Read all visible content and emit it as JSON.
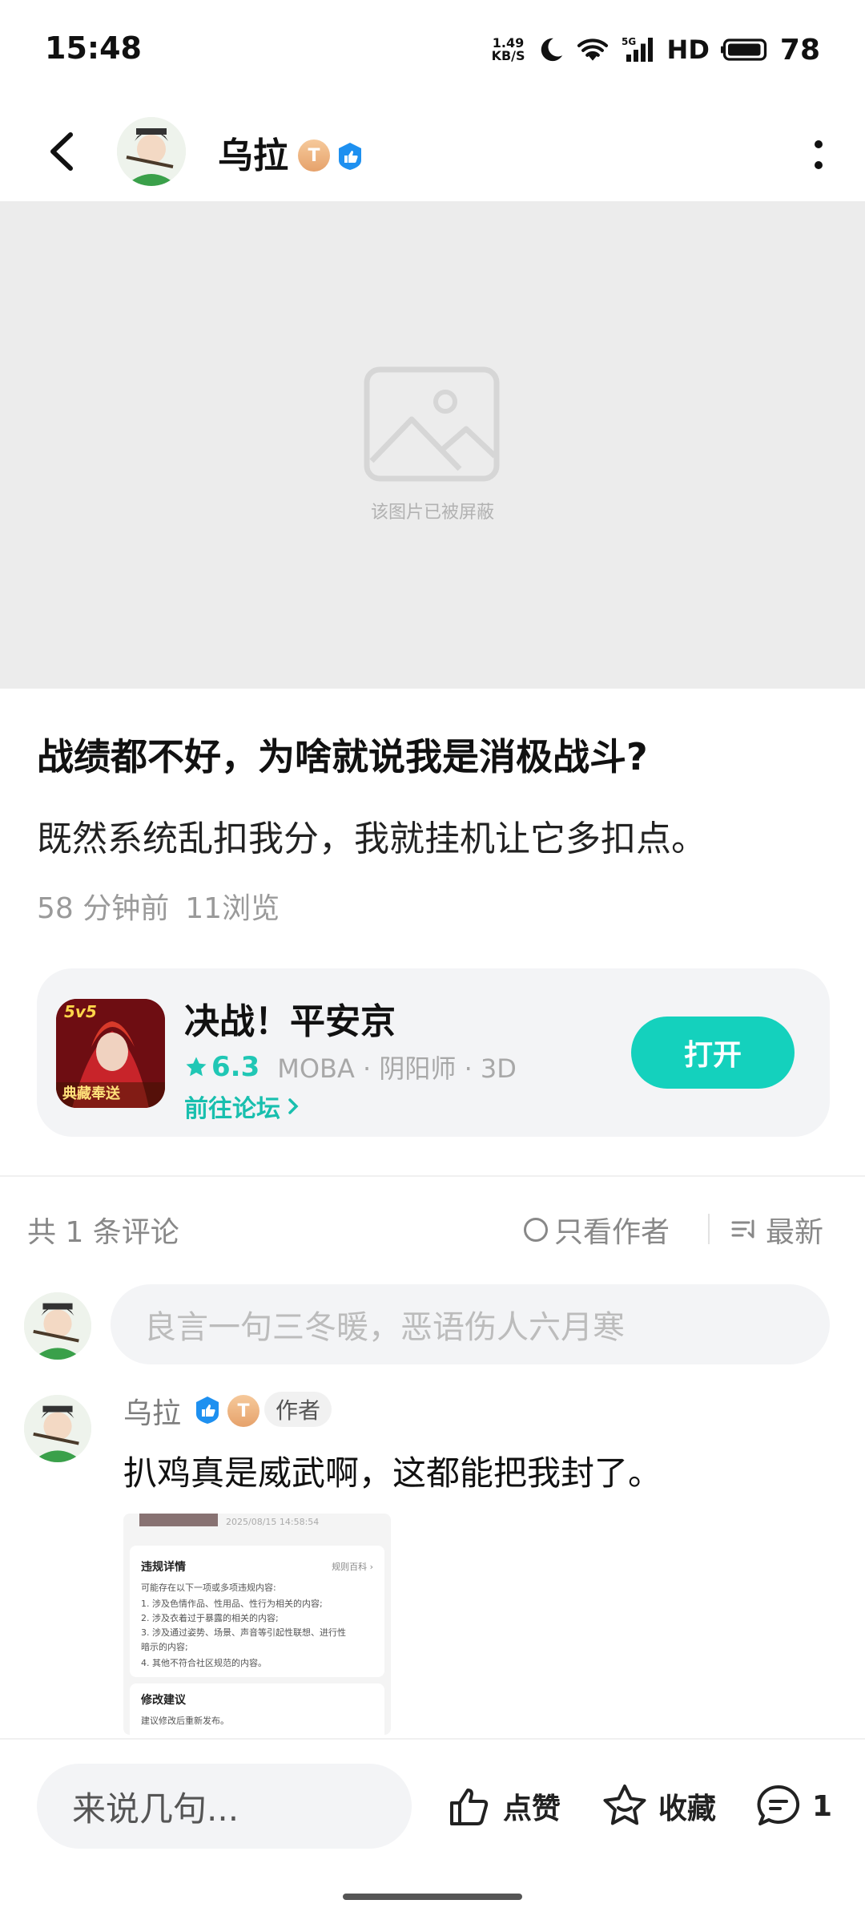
{
  "status_bar": {
    "time": "15:48",
    "net_speed_value": "1.49",
    "net_speed_unit": "KB/S",
    "network": "5G",
    "hd": "HD",
    "battery": "78"
  },
  "header": {
    "author_name": "乌拉",
    "level_badge": "T"
  },
  "blocked_image": {
    "text": "该图片已被屏蔽"
  },
  "post": {
    "title": "战绩都不好，为啥就说我是消极战斗?",
    "body": "既然系统乱扣我分，我就挂机让它多扣点。",
    "time": "58 分钟前",
    "views": "11浏览"
  },
  "game_card": {
    "name": "决战！平安京",
    "rating": "6.3",
    "tags": "MOBA · 阴阳师 · 3D",
    "forum_link": "前往论坛",
    "open_button": "打开",
    "icon_text": "5v5",
    "icon_subtext": "典藏奉送"
  },
  "comments": {
    "count_label": "共 1 条评论",
    "only_author": "只看作者",
    "sort": "最新",
    "input_placeholder": "良言一句三冬暖，恶语伤人六月寒",
    "items": [
      {
        "name": "乌拉",
        "level_badge": "T",
        "author_tag": "作者",
        "text": "扒鸡真是威武啊，这都能把我封了。",
        "screenshot": {
          "date": "2025/08/15 14:58:54",
          "title": "违规详情",
          "link": "规则百科 ›",
          "lines": [
            "可能存在以下一项或多项违规内容:",
            "1. 涉及色情作品、性用品、性行为相关的内容;",
            "2. 涉及衣着过于暴露的相关的内容;",
            "3. 涉及通过姿势、场景、声音等引起性联想、进行性",
            "暗示的内容;",
            "4. 其他不符合社区规范的内容。"
          ],
          "section2_title": "修改建议",
          "section2_line": "建议修改后重新发布。"
        }
      }
    ]
  },
  "bottom_bar": {
    "input_placeholder": "来说几句...",
    "like": "点赞",
    "favorite": "收藏",
    "comment_count": "1"
  },
  "colors": {
    "accent": "#14d1bd",
    "verified_blue": "#1e90f0",
    "level_badge": "#e6a26b"
  }
}
